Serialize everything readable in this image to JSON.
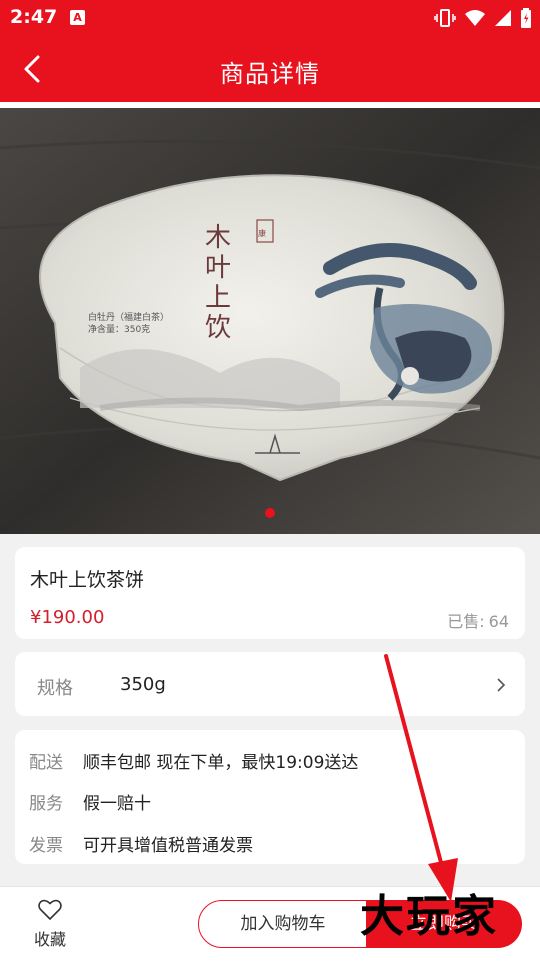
{
  "status_bar": {
    "time": "2:47",
    "app_icon_letter": "A"
  },
  "header": {
    "title": "商品详情"
  },
  "hero": {
    "image_description": "",
    "package_name": "木叶上饮",
    "package_sub1": "白牡丹（福建白茶）",
    "package_sub2": "净含量：350克",
    "slide_count": 1,
    "active_slide": 1
  },
  "product": {
    "name": "木叶上饮茶饼",
    "price": "¥190.00",
    "sold_label": "已售:",
    "sold_count": "64"
  },
  "spec": {
    "label": "规格",
    "value": "350g"
  },
  "info": [
    {
      "key": "配送",
      "value": "顺丰包邮  现在下单，最快19:09送达"
    },
    {
      "key": "服务",
      "value": "假一赔十"
    },
    {
      "key": "发票",
      "value": "可开具增值税普通发票"
    }
  ],
  "bottom": {
    "favorite_label": "收藏",
    "add_to_cart_label": "加入购物车",
    "buy_now_label": "立即购买"
  },
  "overlay": {
    "watermark_text": "大玩家"
  },
  "colors": {
    "accent": "#e8121f",
    "price": "#d2202d"
  }
}
